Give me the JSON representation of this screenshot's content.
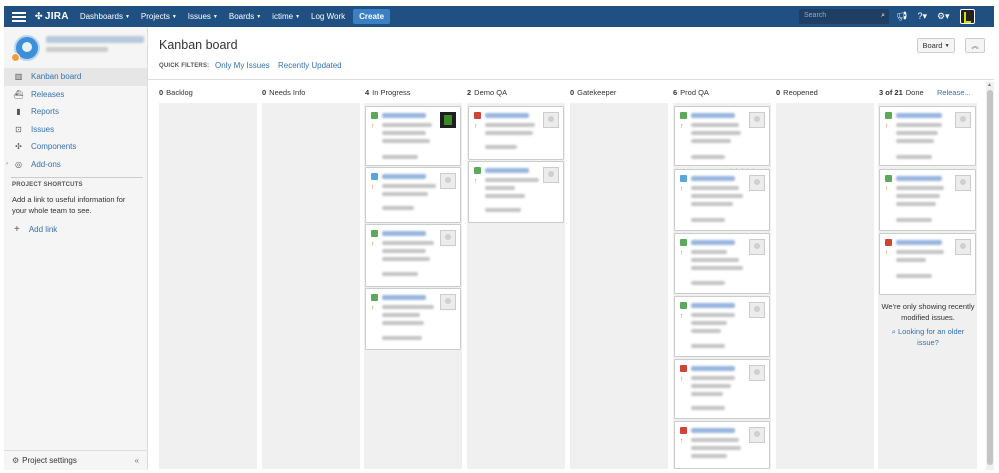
{
  "nav": {
    "logo": "JIRA",
    "items": [
      {
        "label": "Dashboards",
        "caret": true
      },
      {
        "label": "Projects",
        "caret": true
      },
      {
        "label": "Issues",
        "caret": true
      },
      {
        "label": "Boards",
        "caret": true
      },
      {
        "label": "ictime",
        "caret": true
      },
      {
        "label": "Log Work",
        "caret": false
      }
    ],
    "create_label": "Create",
    "search_placeholder": "Search",
    "color": "#205081"
  },
  "sidebar": {
    "items": [
      {
        "label": "Kanban board",
        "icon": "board-icon",
        "glyph": "▥",
        "active": true
      },
      {
        "label": "Releases",
        "icon": "ship-icon",
        "glyph": "⛴",
        "active": false
      },
      {
        "label": "Reports",
        "icon": "reports-icon",
        "glyph": "▮",
        "active": false
      },
      {
        "label": "Issues",
        "icon": "issues-icon",
        "glyph": "⊡",
        "active": false
      },
      {
        "label": "Components",
        "icon": "puzzle-icon",
        "glyph": "✣",
        "active": false
      },
      {
        "label": "Add-ons",
        "icon": "addons-icon",
        "glyph": "◎",
        "active": false
      }
    ],
    "shortcuts_heading": "PROJECT SHORTCUTS",
    "shortcuts_desc": "Add a link to useful information for your whole team to see.",
    "add_link": "Add link",
    "settings": "Project settings",
    "collapse_glyph": "«"
  },
  "board": {
    "title": "Kanban board",
    "quick_filters_label": "QUICK FILTERS:",
    "filters": [
      "Only My Issues",
      "Recently Updated"
    ],
    "board_button": "Board",
    "release_link": "Release...",
    "done_info": "We're only showing recently modified issues.",
    "older_link": "Looking for an older issue?",
    "columns": [
      {
        "count": "0",
        "name": "Backlog"
      },
      {
        "count": "0",
        "name": "Needs Info"
      },
      {
        "count": "4",
        "name": "In Progress"
      },
      {
        "count": "2",
        "name": "Demo QA"
      },
      {
        "count": "0",
        "name": "Gatekeeper"
      },
      {
        "count": "6",
        "name": "Prod QA"
      },
      {
        "count": "0",
        "name": "Reopened"
      },
      {
        "count": "3 of 21",
        "name": "Done"
      }
    ]
  },
  "colors": {
    "story": "#5ca95c",
    "task": "#5aa6dc",
    "bug": "#d04437",
    "priority": "#e0791a",
    "link": "#3572b0"
  }
}
